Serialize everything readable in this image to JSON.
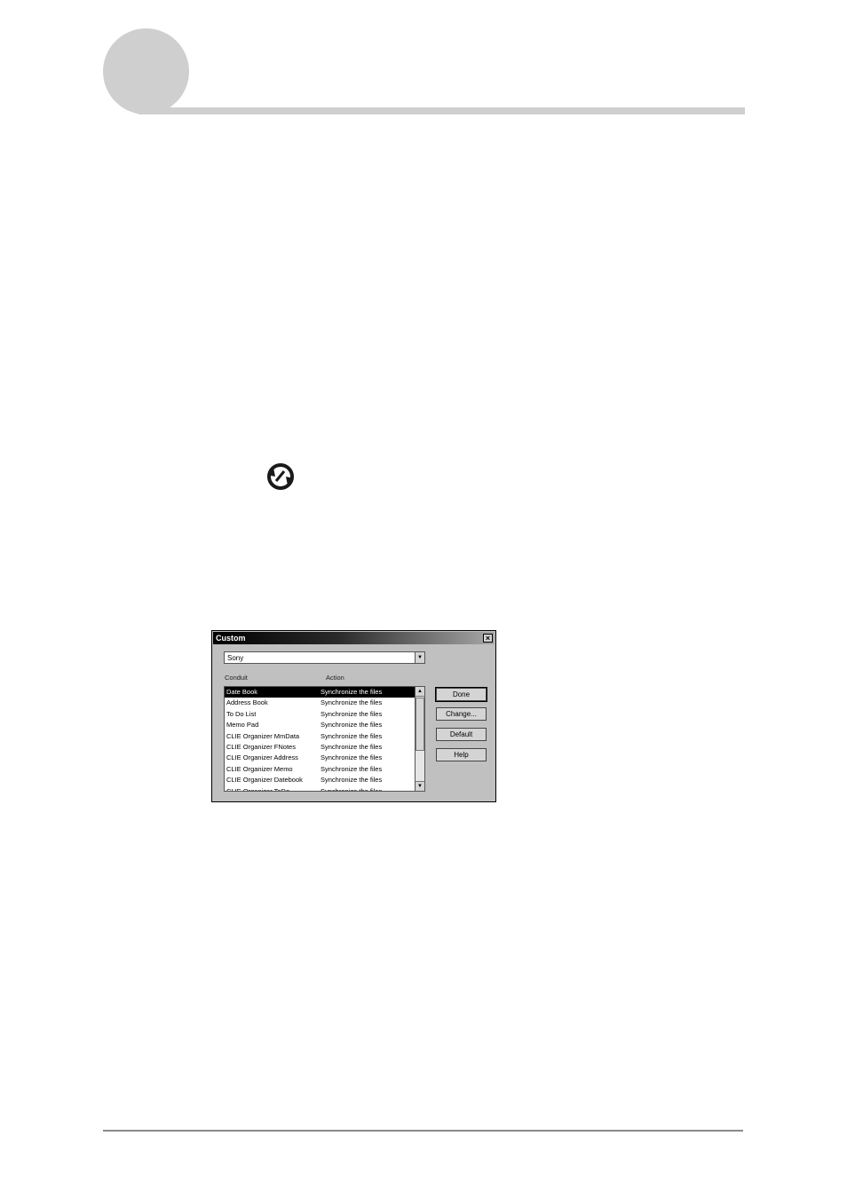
{
  "dialog": {
    "title": "Custom",
    "close_glyph": "×",
    "handheld_select": {
      "value": "Sony",
      "arrow": "▼"
    },
    "columns": {
      "conduit": "Conduit",
      "action": "Action"
    },
    "rows": [
      {
        "conduit": "Date Book",
        "action": "Synchronize the files",
        "selected": true
      },
      {
        "conduit": "Address Book",
        "action": "Synchronize the files"
      },
      {
        "conduit": "To Do List",
        "action": "Synchronize the files"
      },
      {
        "conduit": "Memo Pad",
        "action": "Synchronize the files"
      },
      {
        "conduit": "CLIE Organizer MmData",
        "action": "Synchronize the files"
      },
      {
        "conduit": "CLIE Organizer FNotes",
        "action": "Synchronize the files"
      },
      {
        "conduit": "CLIE Organizer Address",
        "action": "Synchronize the files"
      },
      {
        "conduit": "CLIE Organizer Memo",
        "action": "Synchronize the files"
      },
      {
        "conduit": "CLIE Organizer Datebook",
        "action": "Synchronize the files"
      },
      {
        "conduit": "CLIE Organizer ToDo",
        "action": "Synchronize the files"
      }
    ],
    "scroll_up": "▲",
    "scroll_down": "▼",
    "buttons": {
      "done": "Done",
      "change": "Change...",
      "default": "Default",
      "help": "Help"
    }
  },
  "icons": {
    "sync": "hotsync-icon"
  },
  "colors": {
    "chapter_circle": "#cfcfcf",
    "header_rule": "#cfcfcf",
    "titlebar_start": "#000000",
    "titlebar_end": "#a8a8a8",
    "dialog_bg": "#c0c0c0"
  }
}
